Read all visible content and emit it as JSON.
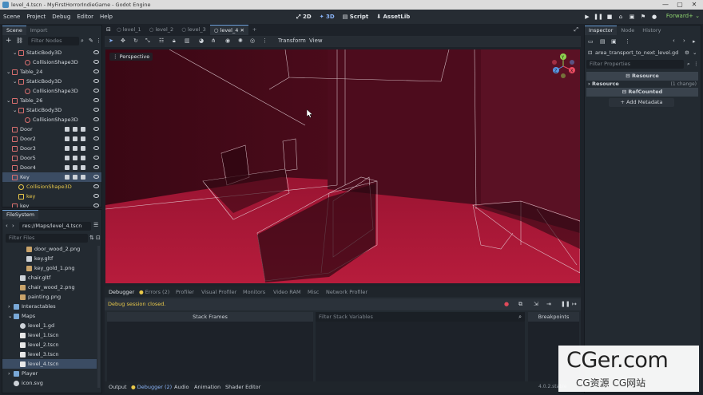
{
  "window": {
    "title": "level_4.tscn - MyFirstHorrorIndieGame - Godot Engine",
    "controls": [
      "—",
      "▢",
      "✕"
    ]
  },
  "menu": {
    "items": [
      "Scene",
      "Project",
      "Debug",
      "Editor",
      "Help"
    ]
  },
  "workspaces": [
    "2D",
    "3D",
    "Script",
    "AssetLib"
  ],
  "renderer": "Forward+",
  "scene_dock": {
    "tabs": [
      "Scene",
      "Import"
    ],
    "filter_placeholder": "Filter Nodes",
    "nodes": [
      {
        "label": "StaticBody3D",
        "indent": 2,
        "color": "#d96f6f",
        "selected": false
      },
      {
        "label": "CollisionShape3D",
        "indent": 3,
        "color": "#d96f6f",
        "selected": false
      },
      {
        "label": "Table_24",
        "indent": 1,
        "color": "#d96f6f",
        "selected": false
      },
      {
        "label": "StaticBody3D",
        "indent": 2,
        "color": "#d96f6f",
        "selected": false
      },
      {
        "label": "CollisionShape3D",
        "indent": 3,
        "color": "#d96f6f",
        "selected": false
      },
      {
        "label": "Table_26",
        "indent": 1,
        "color": "#d96f6f",
        "selected": false
      },
      {
        "label": "StaticBody3D",
        "indent": 2,
        "color": "#d96f6f",
        "selected": false
      },
      {
        "label": "CollisionShape3D",
        "indent": 3,
        "color": "#d96f6f",
        "selected": false
      },
      {
        "label": "Door",
        "indent": 1,
        "color": "#d96f6f",
        "selected": false
      },
      {
        "label": "Door2",
        "indent": 1,
        "color": "#d96f6f",
        "selected": false
      },
      {
        "label": "Door3",
        "indent": 1,
        "color": "#d96f6f",
        "selected": false
      },
      {
        "label": "Door5",
        "indent": 1,
        "color": "#d96f6f",
        "selected": false
      },
      {
        "label": "Door4",
        "indent": 1,
        "color": "#d96f6f",
        "selected": false
      },
      {
        "label": "Key",
        "indent": 1,
        "color": "#d96f6f",
        "selected": true
      },
      {
        "label": "CollisionShape3D",
        "indent": 2,
        "color": "#e8c84a",
        "selected": false
      },
      {
        "label": "key",
        "indent": 2,
        "color": "#e8c84a",
        "selected": false
      },
      {
        "label": "key",
        "indent": 1,
        "color": "#d96f6f",
        "selected": false
      }
    ]
  },
  "filesystem": {
    "tab": "FileSystem",
    "path": "res://Maps/level_4.tscn",
    "filter_placeholder": "Filter Files",
    "items": [
      {
        "label": "door_wood_2.png",
        "indent": 3,
        "kind": "img"
      },
      {
        "label": "key.gltf",
        "indent": 3,
        "kind": "file"
      },
      {
        "label": "key_gold_1.png",
        "indent": 3,
        "kind": "img"
      },
      {
        "label": "chair.gltf",
        "indent": 2,
        "kind": "file"
      },
      {
        "label": "chair_wood_2.png",
        "indent": 2,
        "kind": "img"
      },
      {
        "label": "painting.png",
        "indent": 2,
        "kind": "img"
      },
      {
        "label": "Interactables",
        "indent": 1,
        "kind": "folder"
      },
      {
        "label": "Maps",
        "indent": 1,
        "kind": "folder"
      },
      {
        "label": "level_1.gd",
        "indent": 2,
        "kind": "gear"
      },
      {
        "label": "level_1.tscn",
        "indent": 2,
        "kind": "scene"
      },
      {
        "label": "level_2.tscn",
        "indent": 2,
        "kind": "scene"
      },
      {
        "label": "level_3.tscn",
        "indent": 2,
        "kind": "scene"
      },
      {
        "label": "level_4.tscn",
        "indent": 2,
        "kind": "scene",
        "selected": true
      },
      {
        "label": "Player",
        "indent": 1,
        "kind": "folder"
      },
      {
        "label": "icon.svg",
        "indent": 1,
        "kind": "gear"
      }
    ]
  },
  "editor_tabs": [
    "level_1",
    "level_2",
    "level_3",
    "level_4"
  ],
  "viewport": {
    "toolbar_menus": [
      "Transform",
      "View"
    ],
    "view_label": "Perspective"
  },
  "bottom_panel": {
    "tabs": [
      "Debugger",
      "Errors (2)",
      "Profiler",
      "Visual Profiler",
      "Monitors",
      "Video RAM",
      "Misc",
      "Network Profiler"
    ],
    "status": "Debug session closed.",
    "stack_frames": "Stack Frames",
    "filter_vars_placeholder": "Filter Stack Variables",
    "breakpoints": "Breakpoints",
    "footer_tabs": [
      "Output",
      "Debugger (2)",
      "Audio",
      "Animation",
      "Shader Editor"
    ],
    "version": "4.0.2.stable"
  },
  "inspector": {
    "tabs": [
      "Inspector",
      "Node",
      "History"
    ],
    "script": "area_transport_to_next_level.gd",
    "filter_placeholder": "Filter Properties",
    "section_resource": "Resource",
    "prop_resource": "Resource",
    "prop_changes": "(1 change)",
    "refcounted": "RefCounted",
    "add_metadata": "Add Metadata"
  },
  "watermark": {
    "logo": "CGer.com",
    "sub": "CG资源 CG网站"
  }
}
